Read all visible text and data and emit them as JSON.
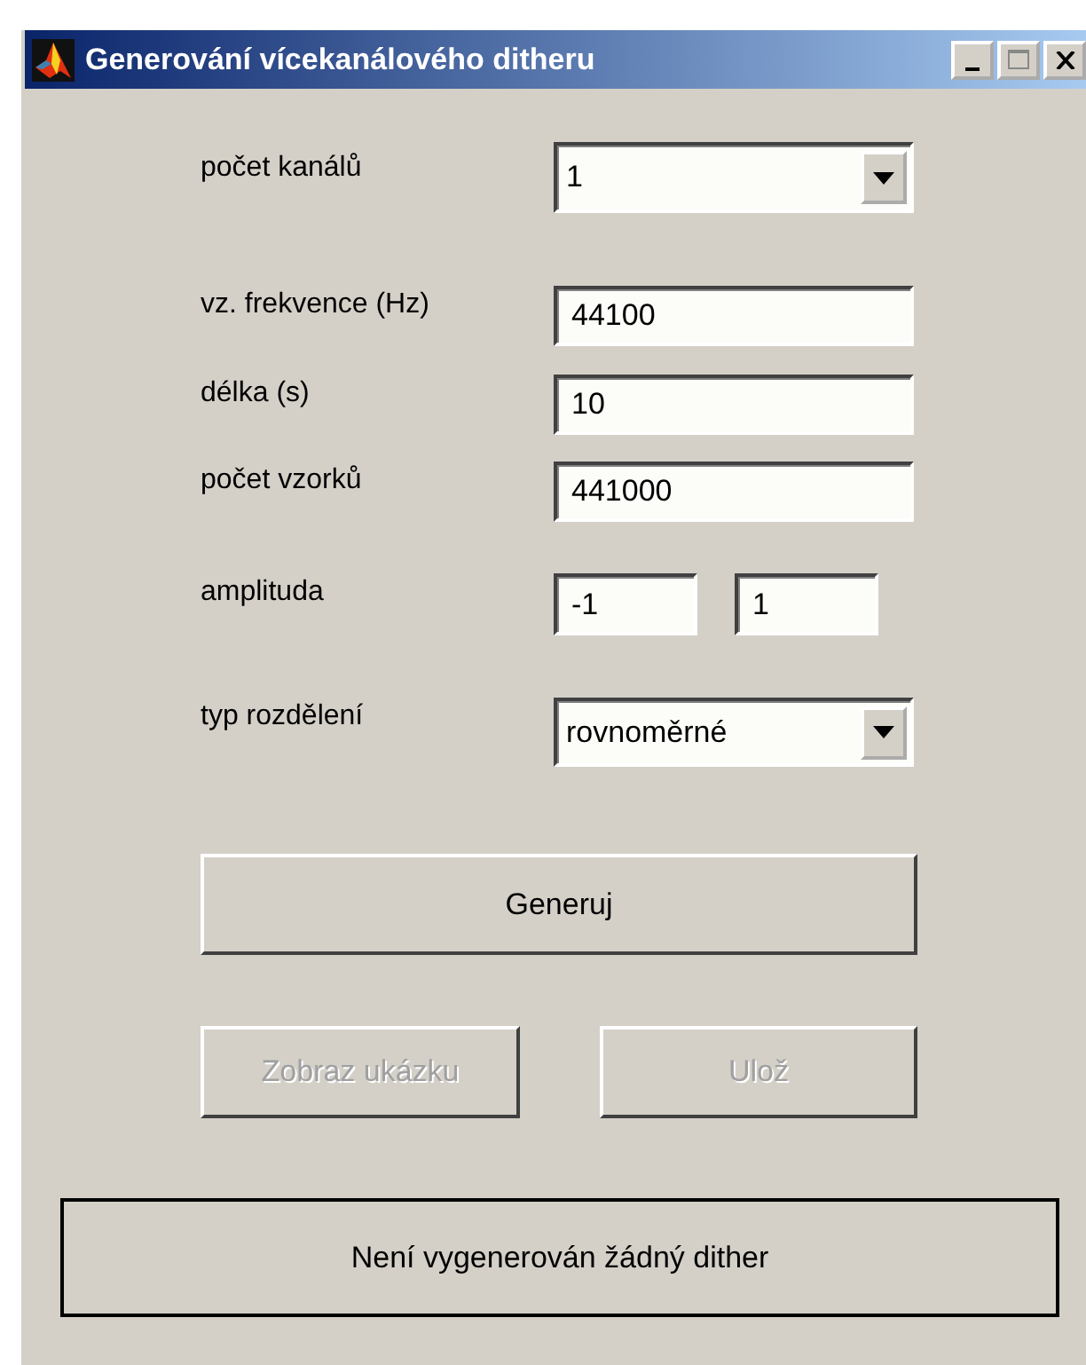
{
  "window": {
    "title": "Generování vícekanálového ditheru"
  },
  "fields": [
    {
      "kind": "dropdown",
      "label": "počet kanálů",
      "value": "1"
    },
    {
      "kind": "text",
      "label": "vz. frekvence (Hz)",
      "value": "44100"
    },
    {
      "kind": "text",
      "label": "délka (s)",
      "value": "10"
    },
    {
      "kind": "text",
      "label": "počet vzorků",
      "value": "441000"
    },
    {
      "kind": "range",
      "label": "amplituda",
      "values": [
        "-1",
        "1"
      ]
    },
    {
      "kind": "dropdown",
      "label": "typ rozdělení",
      "value": "rovnoměrné"
    }
  ],
  "generate_button": {
    "label": "Generuj",
    "disabled": false
  },
  "buttons": [
    {
      "label": "Zobraz ukázku",
      "disabled": true
    },
    {
      "label": "Ulož",
      "disabled": true
    }
  ],
  "status": "Není vygenerován žádný dither"
}
